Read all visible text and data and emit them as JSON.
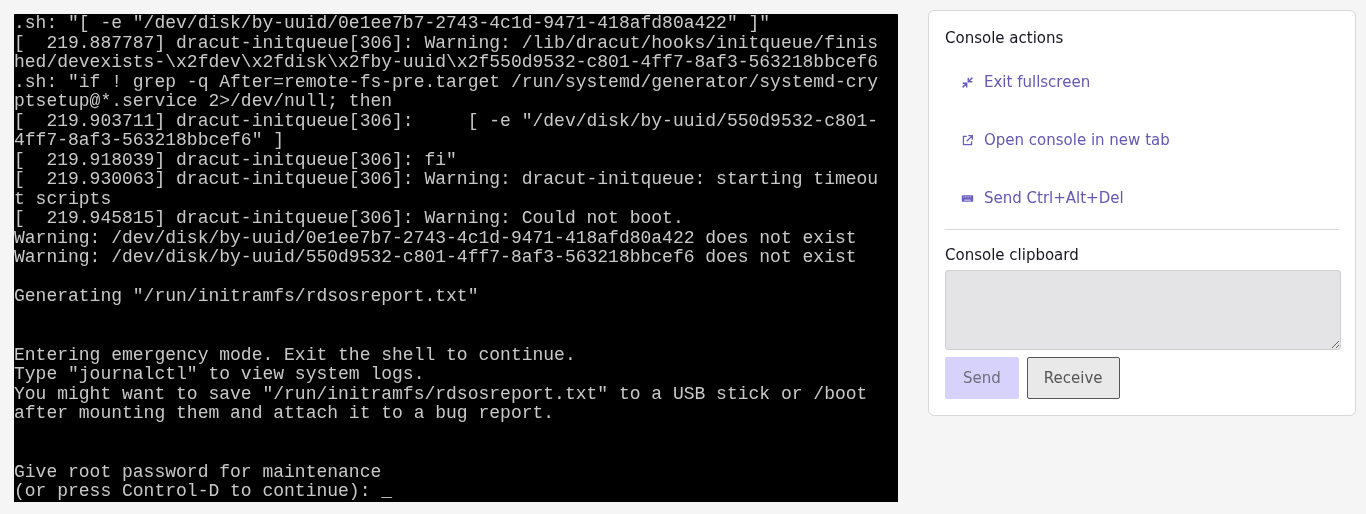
{
  "console": {
    "lines": [
      {
        "kind": "text",
        "text": ".sh: \"[ -e \"/dev/disk/by-uuid/0e1ee7b7-2743-4c1d-9471-418afd80a422\" ]\""
      },
      {
        "kind": "text",
        "text": "[  219.887787] dracut-initqueue[306]: Warning: /lib/dracut/hooks/initqueue/finis"
      },
      {
        "kind": "text",
        "text": "hed/devexists-\\x2fdev\\x2fdisk\\x2fby-uuid\\x2f550d9532-c801-4ff7-8af3-563218bbcef6"
      },
      {
        "kind": "text",
        "text": ".sh: \"if ! grep -q After=remote-fs-pre.target /run/systemd/generator/systemd-cry"
      },
      {
        "kind": "text",
        "text": "ptsetup@*.service 2>/dev/null; then"
      },
      {
        "kind": "text",
        "text": "[  219.903711] dracut-initqueue[306]:     [ -e \"/dev/disk/by-uuid/550d9532-c801-"
      },
      {
        "kind": "text",
        "text": "4ff7-8af3-563218bbcef6\" ]"
      },
      {
        "kind": "text",
        "text": "[  219.918039] dracut-initqueue[306]: fi\""
      },
      {
        "kind": "text",
        "text": "[  219.930063] dracut-initqueue[306]: Warning: dracut-initqueue: starting timeou"
      },
      {
        "kind": "text",
        "text": "t scripts"
      },
      {
        "kind": "text",
        "text": "[  219.945815] dracut-initqueue[306]: Warning: Could not boot."
      },
      {
        "kind": "text",
        "text": "Warning: /dev/disk/by-uuid/0e1ee7b7-2743-4c1d-9471-418afd80a422 does not exist"
      },
      {
        "kind": "text",
        "text": "Warning: /dev/disk/by-uuid/550d9532-c801-4ff7-8af3-563218bbcef6 does not exist"
      },
      {
        "kind": "blank"
      },
      {
        "kind": "text",
        "text": "Generating \"/run/initramfs/rdsosreport.txt\""
      },
      {
        "kind": "blank"
      },
      {
        "kind": "blank"
      },
      {
        "kind": "text",
        "text": "Entering emergency mode. Exit the shell to continue."
      },
      {
        "kind": "text",
        "text": "Type \"journalctl\" to view system logs."
      },
      {
        "kind": "text",
        "text": "You might want to save \"/run/initramfs/rdsosreport.txt\" to a USB stick or /boot"
      },
      {
        "kind": "text",
        "text": "after mounting them and attach it to a bug report."
      },
      {
        "kind": "blank"
      },
      {
        "kind": "blank"
      },
      {
        "kind": "text",
        "text": "Give root password for maintenance"
      },
      {
        "kind": "text",
        "text": "(or press Control-D to continue): _"
      }
    ]
  },
  "panel": {
    "actions_title": "Console actions",
    "actions": [
      {
        "kind": "compress",
        "label": "Exit fullscreen"
      },
      {
        "kind": "external",
        "label": "Open console in new tab"
      },
      {
        "kind": "keyboard",
        "label": "Send Ctrl+Alt+Del"
      }
    ],
    "clipboard_title": "Console clipboard",
    "buttons": [
      {
        "label": "Send",
        "disabled": true
      },
      {
        "label": "Receive",
        "disabled": false
      }
    ]
  }
}
